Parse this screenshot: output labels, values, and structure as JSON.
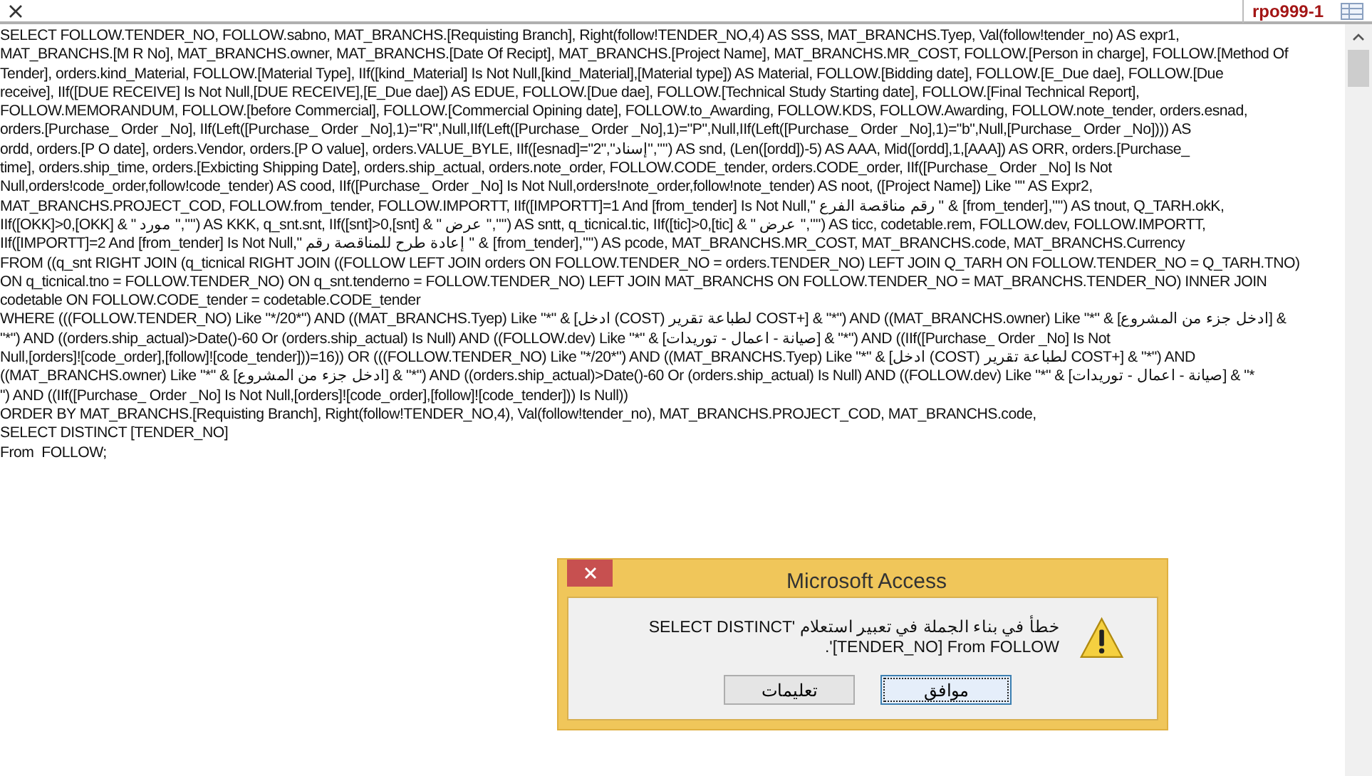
{
  "tab": {
    "label": "rpo999-1"
  },
  "sql_lines": [
    "SELECT FOLLOW.TENDER_NO, FOLLOW.sabno, MAT_BRANCHS.[Requisting Branch], Right(follow!TENDER_NO,4) AS SSS, MAT_BRANCHS.Tyep, Val(follow!tender_no) AS expr1,",
    "MAT_BRANCHS.[M R No], MAT_BRANCHS.owner, MAT_BRANCHS.[Date Of Recipt], MAT_BRANCHS.[Project Name], MAT_BRANCHS.MR_COST, FOLLOW.[Person in charge], FOLLOW.[Method Of",
    "Tender], orders.kind_Material, FOLLOW.[Material Type], IIf([kind_Material] Is Not Null,[kind_Material],[Material type]) AS Material, FOLLOW.[Bidding date], FOLLOW.[E_Due dae], FOLLOW.[Due",
    "receive], IIf([DUE RECEIVE] Is Not Null,[DUE RECEIVE],[E_Due dae]) AS EDUE, FOLLOW.[Due dae], FOLLOW.[Technical Study Starting date], FOLLOW.[Final Technical Report],",
    "FOLLOW.MEMORANDUM, FOLLOW.[before Commercial], FOLLOW.[Commercial Opining date], FOLLOW.to_Awarding, FOLLOW.KDS, FOLLOW.Awarding, FOLLOW.note_tender, orders.esnad,",
    "orders.[Purchase_ Order _No], IIf(Left([Purchase_ Order _No],1)=\"R\",Null,IIf(Left([Purchase_ Order _No],1)=\"P\",Null,IIf(Left([Purchase_ Order _No],1)=\"b\",Null,[Purchase_ Order _No]))) AS",
    "ordd, orders.[P O date], orders.Vendor, orders.[P O value], orders.VALUE_BYLE, IIf([esnad]=\"2\",\"إسناد\",\"\") AS snd, (Len([ordd])-5) AS AAA, Mid([ordd],1,[AAA]) AS ORR, orders.[Purchase_",
    "time], orders.ship_time, orders.[Exbicting Shipping Date], orders.ship_actual, orders.note_order, FOLLOW.CODE_tender, orders.CODE_order, IIf([Purchase_ Order _No] Is Not",
    "Null,orders!code_order,follow!code_tender) AS cood, IIf([Purchase_ Order _No] Is Not Null,orders!note_order,follow!note_tender) AS noot, ([Project Name]) Like \"\" AS Expr2,",
    "MAT_BRANCHS.PROJECT_COD, FOLLOW.from_tender, FOLLOW.IMPORTT, IIf([IMPORTT]=1 And [from_tender] Is Not Null,\" رقم مناقصة الفرع \" & [from_tender],\"\") AS tnout, Q_TARH.okK,",
    "IIf([OKK]>0,[OKK] & \" مورد \",\"\") AS KKK, q_snt.snt, IIf([snt]>0,[snt] & \" عرض \",\"\") AS sntt, q_ticnical.tic, IIf([tic]>0,[tic] & \" عرض \",\"\") AS ticc, codetable.rem, FOLLOW.dev, FOLLOW.IMPORTT,",
    "IIf([IMPORTT]=2 And [from_tender] Is Not Null,\" إعادة طرح للمناقصة رقم \" & [from_tender],\"\") AS pcode, MAT_BRANCHS.MR_COST, MAT_BRANCHS.code, MAT_BRANCHS.Currency",
    "FROM ((q_snt RIGHT JOIN (q_ticnical RIGHT JOIN ((FOLLOW LEFT JOIN orders ON FOLLOW.TENDER_NO = orders.TENDER_NO) LEFT JOIN Q_TARH ON FOLLOW.TENDER_NO = Q_TARH.TNO)",
    "ON q_ticnical.tno = FOLLOW.TENDER_NO) ON q_snt.tenderno = FOLLOW.TENDER_NO) LEFT JOIN MAT_BRANCHS ON FOLLOW.TENDER_NO = MAT_BRANCHS.TENDER_NO) INNER JOIN",
    "codetable ON FOLLOW.CODE_tender = codetable.CODE_tender",
    "WHERE (((FOLLOW.TENDER_NO) Like \"*/20*\") AND ((MAT_BRANCHS.Tyep) Like \"*\" & [ادخل (COST) لطباعة تقرير COST+] & \"*\") AND ((MAT_BRANCHS.owner) Like \"*\" & [ادخل جزء من المشروع] &",
    "\"*\") AND ((orders.ship_actual)>Date()-60 Or (orders.ship_actual) Is Null) AND ((FOLLOW.dev) Like \"*\" & [صيانة - اعمال - توريدات] & \"*\") AND ((IIf([Purchase_ Order _No] Is Not",
    "Null,[orders]![code_order],[follow]![code_tender]))=16)) OR (((FOLLOW.TENDER_NO) Like \"*/20*\") AND ((MAT_BRANCHS.Tyep) Like \"*\" & [ادخل (COST) لطباعة تقرير COST+] & \"*\") AND",
    "((MAT_BRANCHS.owner) Like \"*\" & [ادخل جزء من المشروع] & \"*\") AND ((orders.ship_actual)>Date()-60 Or (orders.ship_actual) Is Null) AND ((FOLLOW.dev) Like \"*\" & [صيانة - اعمال - توريدات] & \"*",
    "\") AND ((IIf([Purchase_ Order _No] Is Not Null,[orders]![code_order],[follow]![code_tender])) Is Null))",
    "ORDER BY MAT_BRANCHS.[Requisting Branch], Right(follow!TENDER_NO,4), Val(follow!tender_no), MAT_BRANCHS.PROJECT_COD, MAT_BRANCHS.code,",
    "SELECT DISTINCT [TENDER_NO]",
    "From  FOLLOW;"
  ],
  "dialog": {
    "title": "Microsoft Access",
    "message": "خطأ في بناء الجملة في تعبير استعلام 'SELECT DISTINCT [TENDER_NO] From  FOLLOW'.",
    "buttons": [
      {
        "label": "موافق",
        "focused": true
      },
      {
        "label": "تعليمات",
        "focused": false
      }
    ]
  }
}
